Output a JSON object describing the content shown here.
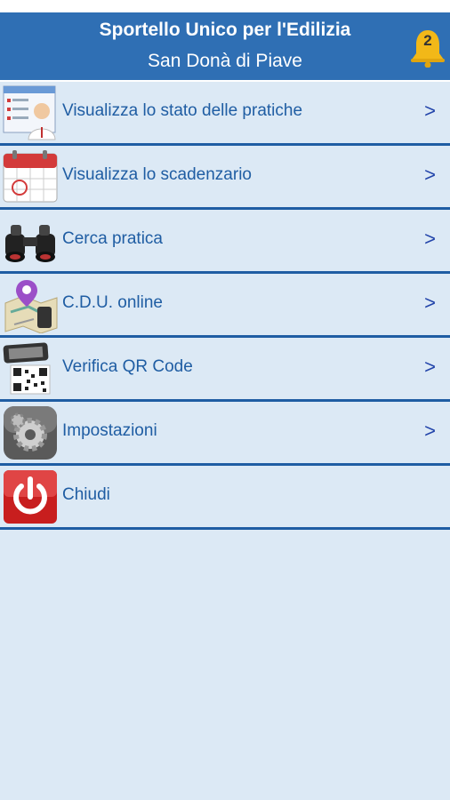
{
  "header": {
    "title": "Sportello Unico per l'Edilizia",
    "subtitle": "San Donà di Piave",
    "notification_count": "2"
  },
  "colors": {
    "header_bg": "#2f6fb4",
    "page_bg": "#dce9f5",
    "divider": "#1f5da3",
    "label_text": "#1f5da3",
    "bell": "#f2b818"
  },
  "menu": [
    {
      "label": "Visualizza lo stato delle pratiche",
      "chevron": ">",
      "icon": "document-user-icon"
    },
    {
      "label": "Visualizza lo scadenzario",
      "chevron": ">",
      "icon": "calendar-icon"
    },
    {
      "label": "Cerca pratica",
      "chevron": ">",
      "icon": "binoculars-icon"
    },
    {
      "label": "C.D.U. online",
      "chevron": ">",
      "icon": "map-pin-icon"
    },
    {
      "label": "Verifica QR Code",
      "chevron": ">",
      "icon": "qr-code-phone-icon"
    },
    {
      "label": "Impostazioni",
      "chevron": ">",
      "icon": "gear-icon"
    },
    {
      "label": "Chiudi",
      "chevron": "",
      "icon": "power-icon"
    }
  ]
}
